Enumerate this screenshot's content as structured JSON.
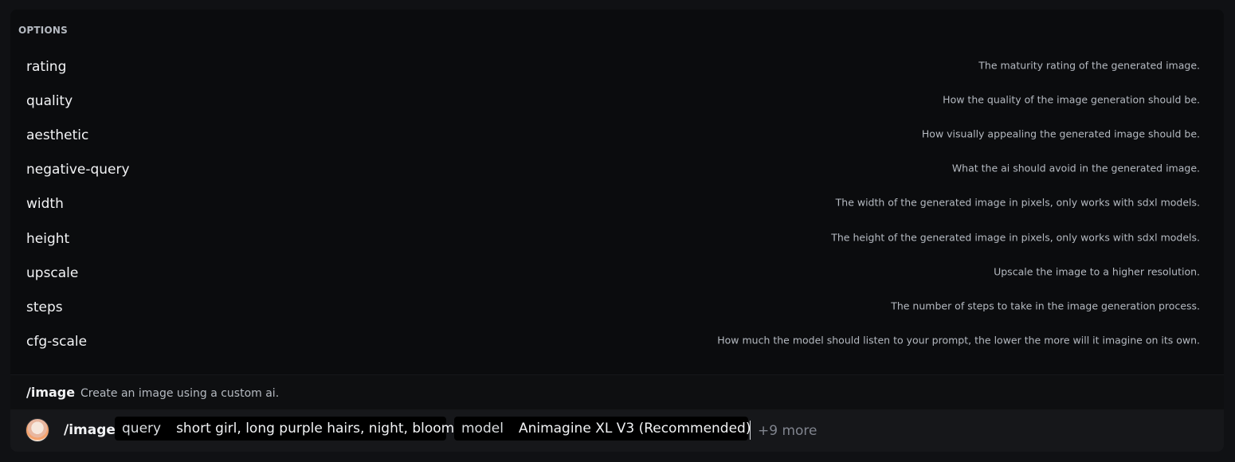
{
  "options_header": "OPTIONS",
  "options": [
    {
      "name": "rating",
      "description": "The maturity rating of the generated image."
    },
    {
      "name": "quality",
      "description": "How the quality of the image generation should be."
    },
    {
      "name": "aesthetic",
      "description": "How visually appealing the generated image should be."
    },
    {
      "name": "negative-query",
      "description": "What the ai should avoid in the generated image."
    },
    {
      "name": "width",
      "description": "The width of the generated image in pixels, only works with sdxl models."
    },
    {
      "name": "height",
      "description": "The height of the generated image in pixels, only works with sdxl models."
    },
    {
      "name": "upscale",
      "description": "Upscale the image to a higher resolution."
    },
    {
      "name": "steps",
      "description": "The number of steps to take in the image generation process."
    },
    {
      "name": "cfg-scale",
      "description": "How much the model should listen to your prompt, the lower the more will it imagine on its own."
    }
  ],
  "command_info": {
    "name": "/image",
    "description": "Create an image using a custom ai."
  },
  "input": {
    "command": "/image",
    "params": [
      {
        "key": "query",
        "value": "short girl, long purple hairs, night, bloom"
      },
      {
        "key": "model",
        "value": "Animagine XL V3 (Recommended)"
      }
    ],
    "more": "+9 more"
  }
}
